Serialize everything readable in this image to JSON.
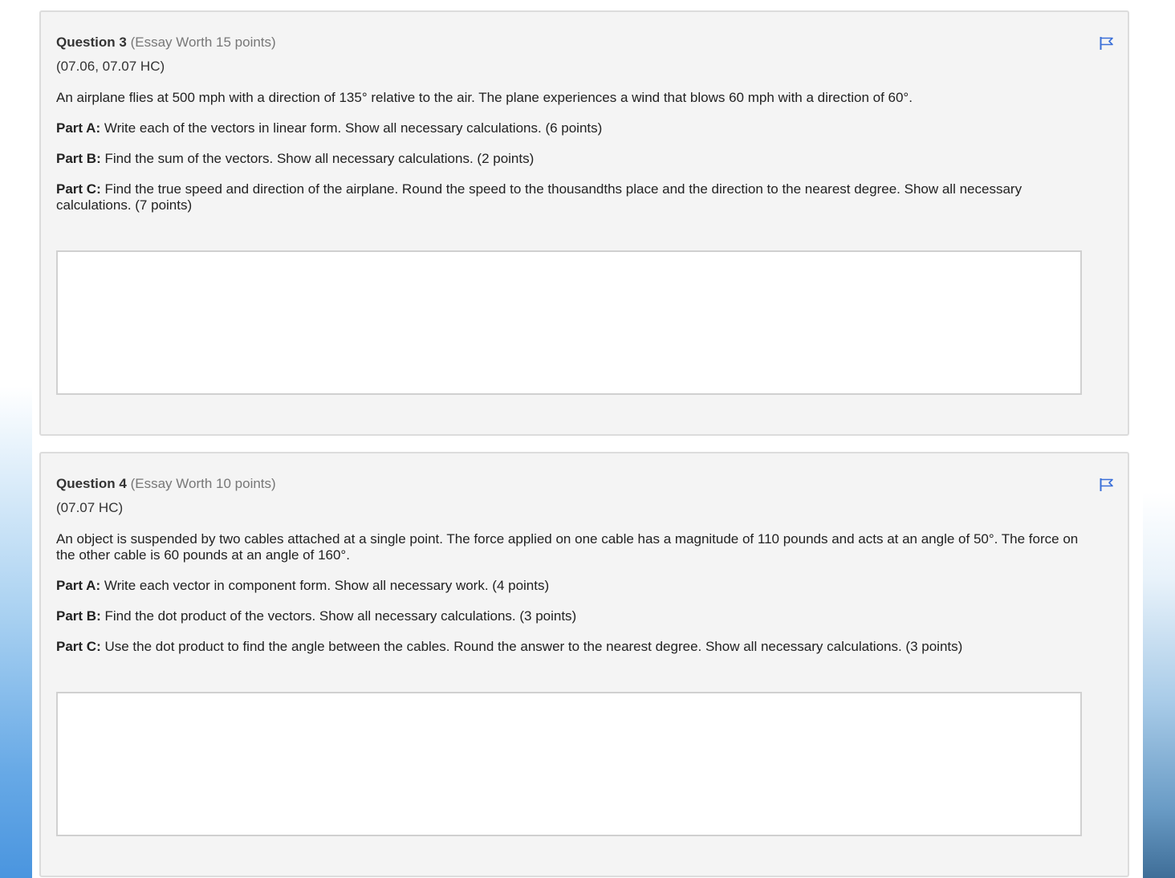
{
  "questions": [
    {
      "number_label": "Question 3",
      "worth": "(Essay Worth 15 points)",
      "code": "(07.06, 07.07 HC)",
      "prompt": "An airplane flies at 500 mph with a direction of 135° relative to the air. The plane experiences a wind that blows 60 mph with a direction of 60°.",
      "parts": [
        {
          "label": "Part A:",
          "text": "Write each of the vectors in linear form. Show all necessary calculations. (6 points)"
        },
        {
          "label": "Part B:",
          "text": "Find the sum of the vectors. Show all necessary calculations. (2 points)"
        },
        {
          "label": "Part C:",
          "text": "Find the true speed and direction of the airplane. Round the speed to the thousandths place and the direction to the nearest degree. Show all necessary calculations. (7 points)"
        }
      ],
      "answer": ""
    },
    {
      "number_label": "Question 4",
      "worth": "(Essay Worth 10 points)",
      "code": "(07.07 HC)",
      "prompt": "An object is suspended by two cables attached at a single point. The force applied on one cable has a magnitude of 110 pounds and acts at an angle of 50°. The force on the other cable is 60 pounds at an angle of 160°.",
      "parts": [
        {
          "label": "Part A:",
          "text": "Write each vector in component form. Show all necessary work. (4 points)"
        },
        {
          "label": "Part B:",
          "text": "Find the dot product of the vectors. Show all necessary calculations. (3 points)"
        },
        {
          "label": "Part C:",
          "text": "Use the dot product to find the angle between the cables. Round the answer to the nearest degree. Show all necessary calculations. (3 points)"
        }
      ],
      "answer": ""
    }
  ],
  "icons": {
    "flag": "flag-icon"
  },
  "colors": {
    "card_bg": "#f4f4f4",
    "card_border": "#dcdcdc",
    "flag": "#3a6fd8",
    "worth_text": "#777777"
  }
}
